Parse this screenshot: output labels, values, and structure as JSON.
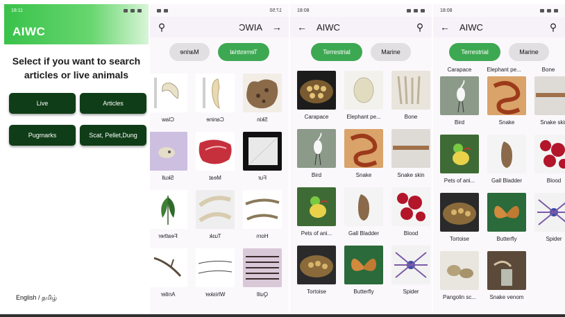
{
  "screen1": {
    "time": "18:11",
    "app_title": "AIWC",
    "prompt": "Select if you want to search articles or live animals",
    "buttons": [
      "Live",
      "Articles",
      "Pugmarks",
      "Scat, Pellet,Dung"
    ],
    "language": "English / தமிழ்"
  },
  "screen2": {
    "time": "17:50",
    "app_title": "AIWC",
    "tabs": {
      "active": "Terrestrial",
      "inactive": "Marine"
    },
    "items": [
      "Skin",
      "Canine",
      "Claw",
      "Fur",
      "Meat",
      "Skull",
      "Horn",
      "Tusk",
      "Feather",
      "Quill",
      "Whisker",
      "Antler"
    ]
  },
  "screen3": {
    "time": "18:08",
    "app_title": "AIWC",
    "tabs": {
      "active": "Terrestrial",
      "inactive": "Marine"
    },
    "items": [
      "Carapace",
      "Elephant pe...",
      "Bone",
      "Bird",
      "Snake",
      "Snake skin",
      "Pets of ani...",
      "Gall Bladder",
      "Blood",
      "Tortoise",
      "Butterfly",
      "Spider"
    ]
  },
  "screen4": {
    "time": "18:08",
    "app_title": "AIWC",
    "tabs": {
      "active": "Terrestrial",
      "inactive": "Marine"
    },
    "top_captions": [
      "Carapace",
      "Elephant pe...",
      "Bone"
    ],
    "items": [
      "Bird",
      "Snake",
      "Snake skin",
      "Pets of ani...",
      "Gall Bladder",
      "Blood",
      "Tortoise",
      "Butterfly",
      "Spider",
      "Pangolin sc...",
      "Snake venom"
    ]
  },
  "colors": {
    "header_green": "#39c24a",
    "button_dark": "#0f3d17",
    "chip_green": "#3da852",
    "chip_grey": "#e2dfe3",
    "appbar_bg": "#f7f1f9"
  },
  "icons": {
    "back": "arrow-left-icon",
    "forward": "arrow-right-icon",
    "search": "search-icon"
  }
}
